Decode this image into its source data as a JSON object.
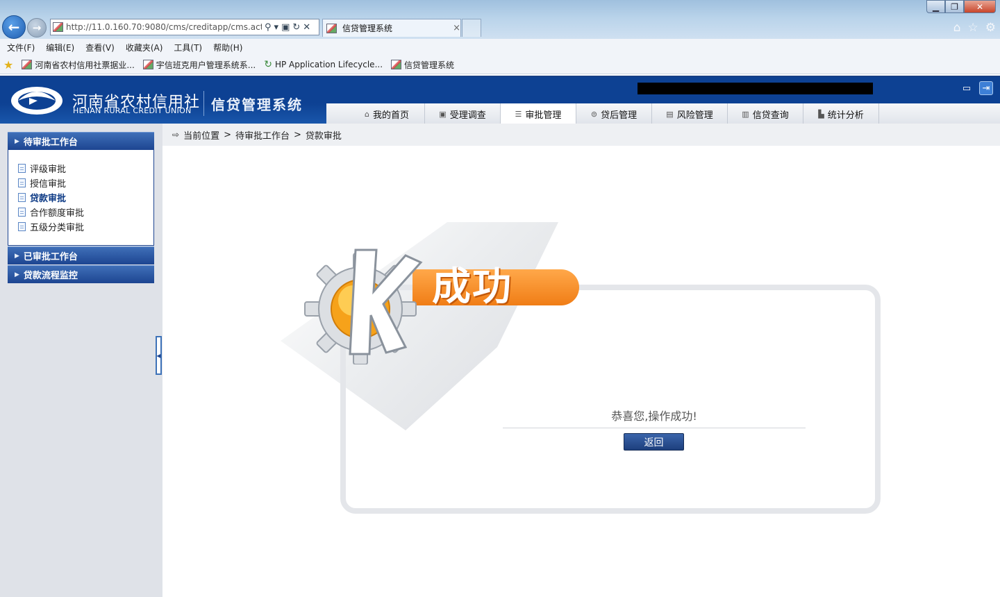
{
  "browser": {
    "address": "http://11.0.160.70:9080/cms/creditapp/cms.actic",
    "tab_title": "信贷管理系统",
    "tab_close": "×",
    "menu": [
      "文件(F)",
      "编辑(E)",
      "查看(V)",
      "收藏夹(A)",
      "工具(T)",
      "帮助(H)"
    ],
    "favorites": [
      "河南省农村信用社票据业...",
      "宇信班克用户管理系统系...",
      "HP Application Lifecycle...",
      "信贷管理系统"
    ]
  },
  "header": {
    "org_cn": "河南省农村信用社",
    "org_en": "HENAN RURAL CREDIT UNION",
    "system_name": "信贷管理系统"
  },
  "nav": [
    {
      "label": "我的首页",
      "icon": "home-icon",
      "active": false
    },
    {
      "label": "受理调查",
      "icon": "survey-icon",
      "active": false
    },
    {
      "label": "审批管理",
      "icon": "list-icon",
      "active": true
    },
    {
      "label": "贷后管理",
      "icon": "coin-icon",
      "active": false
    },
    {
      "label": "风险管理",
      "icon": "risk-icon",
      "active": false
    },
    {
      "label": "信贷查询",
      "icon": "query-icon",
      "active": false
    },
    {
      "label": "统计分析",
      "icon": "chart-icon",
      "active": false
    }
  ],
  "sidebar": {
    "group1": "待审批工作台",
    "items": [
      {
        "label": "评级审批",
        "active": false
      },
      {
        "label": "授信审批",
        "active": false
      },
      {
        "label": "贷款审批",
        "active": true
      },
      {
        "label": "合作额度审批",
        "active": false
      },
      {
        "label": "五级分类审批",
        "active": false
      }
    ],
    "group2": "已审批工作台",
    "group3": "贷款流程监控"
  },
  "breadcrumb": {
    "prefix": "当前位置",
    "sep": ">",
    "level1": "待审批工作台",
    "level2": "贷款审批"
  },
  "result": {
    "banner": "成功",
    "message": "恭喜您,操作成功!",
    "back_button": "返回"
  },
  "colors": {
    "brand_blue": "#0d4193",
    "accent_orange": "#f07d16"
  }
}
